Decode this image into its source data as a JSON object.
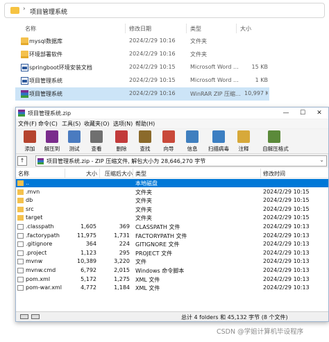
{
  "explorer": {
    "breadcrumb": "项目管理系统",
    "columns": {
      "name": "名称",
      "modified": "修改日期",
      "type": "类型",
      "size": "大小"
    },
    "rows": [
      {
        "name": "mysql数据库",
        "modified": "2024/2/29 10:16",
        "type": "文件夹",
        "size": "",
        "icon": "folder-icon"
      },
      {
        "name": "环境部署软件",
        "modified": "2024/2/29 10:16",
        "type": "文件夹",
        "size": "",
        "icon": "folder-icon"
      },
      {
        "name": "springboot环境安装文档",
        "modified": "2024/2/29 10:15",
        "type": "Microsoft Word ...",
        "size": "15 KB",
        "icon": "word-doc-icon"
      },
      {
        "name": "项目管理系统",
        "modified": "2024/2/29 10:15",
        "type": "Microsoft Word ...",
        "size": "1 KB",
        "icon": "word-doc-icon"
      },
      {
        "name": "项目管理系统",
        "modified": "2024/2/29 10:16",
        "type": "WinRAR ZIP 压缩...",
        "size": "10,997 KB",
        "icon": "winrar-archive-icon"
      }
    ]
  },
  "winrar": {
    "title": "项目管理系统.zip",
    "menu": [
      "文件(F)",
      "命令(C)",
      "工具(S)",
      "收藏夹(O)",
      "选项(N)",
      "帮助(H)"
    ],
    "toolbar": [
      {
        "label": "添加",
        "icon": "add-icon",
        "color": "#b5442e"
      },
      {
        "label": "解压到",
        "icon": "extract-to-icon",
        "color": "#7a2c8c"
      },
      {
        "label": "测试",
        "icon": "test-icon",
        "color": "#4a7bc0"
      },
      {
        "label": "查看",
        "icon": "view-icon",
        "color": "#6f6f6f"
      },
      {
        "label": "删除",
        "icon": "delete-icon",
        "color": "#c23b3b"
      },
      {
        "label": "查找",
        "icon": "find-icon",
        "color": "#8b6a2b"
      },
      {
        "label": "向导",
        "icon": "wizard-icon",
        "color": "#c9493a"
      },
      {
        "label": "信息",
        "icon": "info-icon",
        "color": "#3f7fbf"
      },
      {
        "label": "扫描病毒",
        "icon": "virus-scan-icon",
        "color": "#3c7fc2"
      },
      {
        "label": "注释",
        "icon": "comment-icon",
        "color": "#d7a93a"
      },
      {
        "label": "自解压格式",
        "icon": "sfx-icon",
        "color": "#5b8a3a"
      }
    ],
    "path": "项目管理系统.zip - ZIP 压缩文件, 解包大小为 28,646,270 字节",
    "columns": {
      "name": "名称",
      "size": "大小",
      "packed": "压缩后大小",
      "type": "类型",
      "modified": "修改时间"
    },
    "rows": [
      {
        "name": "..",
        "size": "",
        "packed": "",
        "type": "本地磁盘",
        "modified": "",
        "kind": "updir"
      },
      {
        "name": ".mvn",
        "size": "",
        "packed": "",
        "type": "文件夹",
        "modified": "2024/2/29 10:15",
        "kind": "folder"
      },
      {
        "name": "db",
        "size": "",
        "packed": "",
        "type": "文件夹",
        "modified": "2024/2/29 10:15",
        "kind": "folder"
      },
      {
        "name": "src",
        "size": "",
        "packed": "",
        "type": "文件夹",
        "modified": "2024/2/29 10:15",
        "kind": "folder"
      },
      {
        "name": "target",
        "size": "",
        "packed": "",
        "type": "文件夹",
        "modified": "2024/2/29 10:15",
        "kind": "folder"
      },
      {
        "name": ".classpath",
        "size": "1,605",
        "packed": "369",
        "type": "CLASSPATH 文件",
        "modified": "2024/2/29 10:13",
        "kind": "file"
      },
      {
        "name": ".factorypath",
        "size": "11,975",
        "packed": "1,731",
        "type": "FACTORYPATH 文件",
        "modified": "2024/2/29 10:13",
        "kind": "file"
      },
      {
        "name": ".gitignore",
        "size": "364",
        "packed": "224",
        "type": "GITIGNORE 文件",
        "modified": "2024/2/29 10:13",
        "kind": "file"
      },
      {
        "name": ".project",
        "size": "1,123",
        "packed": "295",
        "type": "PROJECT 文件",
        "modified": "2024/2/29 10:13",
        "kind": "file"
      },
      {
        "name": "mvnw",
        "size": "10,389",
        "packed": "3,220",
        "type": "文件",
        "modified": "2024/2/29 10:13",
        "kind": "file"
      },
      {
        "name": "mvnw.cmd",
        "size": "6,792",
        "packed": "2,015",
        "type": "Windows 命令脚本",
        "modified": "2024/2/29 10:13",
        "kind": "file"
      },
      {
        "name": "pom.xml",
        "size": "5,172",
        "packed": "1,275",
        "type": "XML 文件",
        "modified": "2024/2/29 10:13",
        "kind": "file"
      },
      {
        "name": "pom-war.xml",
        "size": "4,772",
        "packed": "1,184",
        "type": "XML 文件",
        "modified": "2024/2/29 10:13",
        "kind": "file"
      }
    ],
    "status": "总计 4 folders 和 45,132 字节 (8 个文件)"
  },
  "watermark": "CSDN @学姐计算机毕设程序",
  "colors": {
    "selection": "#0078d7",
    "explorer_selection": "#cce4f7",
    "folder": "#f4c14d"
  }
}
